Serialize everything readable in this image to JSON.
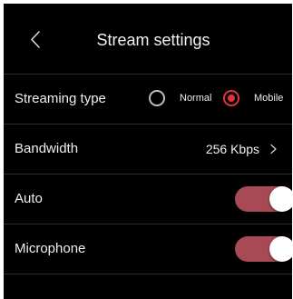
{
  "header": {
    "title": "Stream settings",
    "back_icon": "chevron-left-icon"
  },
  "streaming_type": {
    "label": "Streaming type",
    "options": [
      {
        "label": "Normal",
        "selected": false
      },
      {
        "label": "Mobile",
        "selected": true
      }
    ],
    "accent_color": "#e2333b"
  },
  "bandwidth": {
    "label": "Bandwidth",
    "value": "256 Kbps",
    "icon": "chevron-right-icon"
  },
  "auto": {
    "label": "Auto",
    "enabled": true
  },
  "microphone": {
    "label": "Microphone",
    "enabled": true
  },
  "colors": {
    "background": "#000000",
    "toggle_on": "#a84a55",
    "divider": "#2e2e2e"
  }
}
